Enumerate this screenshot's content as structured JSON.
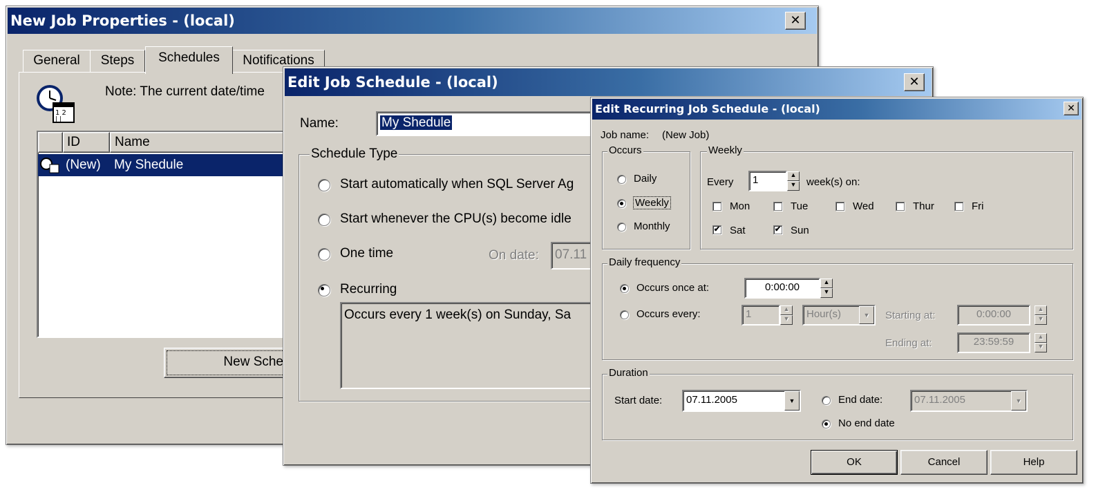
{
  "win1": {
    "title": "New Job Properties - (local)",
    "close": "✕",
    "tabs": [
      "General",
      "Steps",
      "Schedules",
      "Notifications"
    ],
    "note": "Note: The current date/time",
    "columns": [
      "ID",
      "Name"
    ],
    "row": {
      "id": "(New)",
      "name": "My Shedule"
    },
    "new_schedule_button": "New Sched"
  },
  "win2": {
    "title": "Edit Job Schedule - (local)",
    "close": "✕",
    "name_label": "Name:",
    "name_value": "My Shedule",
    "schedule_type_legend": "Schedule Type",
    "opt_auto": "Start automatically when SQL Server Ag",
    "opt_idle": "Start whenever the CPU(s) become idle",
    "opt_onetime": "One time",
    "on_date_label": "On date:",
    "on_date_value": "07.11",
    "opt_recurring": "Recurring",
    "recurring_desc": "Occurs every 1 week(s) on Sunday, Sa"
  },
  "win3": {
    "title": "Edit Recurring Job Schedule - (local)",
    "close": "✕",
    "job_name_label": "Job name:",
    "job_name_value": "(New Job)",
    "occurs": {
      "legend": "Occurs",
      "daily": "Daily",
      "weekly": "Weekly",
      "monthly": "Monthly",
      "selected": "weekly"
    },
    "weekly": {
      "legend": "Weekly",
      "every_label": "Every",
      "every_value": "1",
      "weeks_on": "week(s) on:",
      "days": [
        {
          "label": "Mon",
          "checked": false
        },
        {
          "label": "Tue",
          "checked": false
        },
        {
          "label": "Wed",
          "checked": false
        },
        {
          "label": "Thur",
          "checked": false
        },
        {
          "label": "Fri",
          "checked": false
        },
        {
          "label": "Sat",
          "checked": true
        },
        {
          "label": "Sun",
          "checked": true
        }
      ]
    },
    "daily_freq": {
      "legend": "Daily frequency",
      "once_label": "Occurs once at:",
      "once_value": "0:00:00",
      "every_label": "Occurs every:",
      "every_value": "1",
      "unit_value": "Hour(s)",
      "starting_label": "Starting at:",
      "starting_value": "0:00:00",
      "ending_label": "Ending at:",
      "ending_value": "23:59:59"
    },
    "duration": {
      "legend": "Duration",
      "start_label": "Start date:",
      "start_value": "07.11.2005",
      "end_label": "End date:",
      "end_value": "07.11.2005",
      "no_end_label": "No end date"
    },
    "buttons": {
      "ok": "OK",
      "cancel": "Cancel",
      "help": "Help"
    }
  }
}
